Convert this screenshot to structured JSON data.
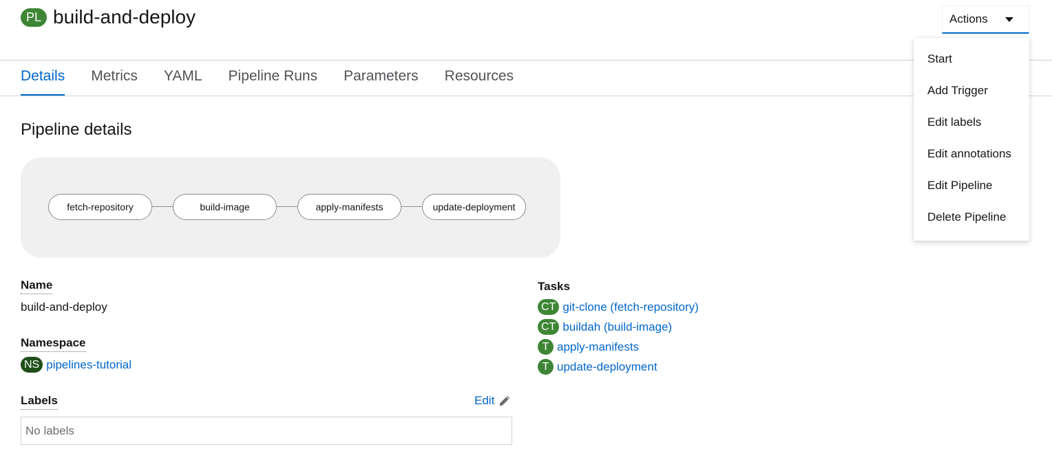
{
  "header": {
    "badge": "PL",
    "title": "build-and-deploy",
    "actions_label": "Actions"
  },
  "actions_menu": {
    "items": [
      "Start",
      "Add Trigger",
      "Edit labels",
      "Edit annotations",
      "Edit Pipeline",
      "Delete Pipeline"
    ]
  },
  "tabs": [
    {
      "label": "Details",
      "active": true
    },
    {
      "label": "Metrics",
      "active": false
    },
    {
      "label": "YAML",
      "active": false
    },
    {
      "label": "Pipeline Runs",
      "active": false
    },
    {
      "label": "Parameters",
      "active": false
    },
    {
      "label": "Resources",
      "active": false
    }
  ],
  "section_title": "Pipeline details",
  "pipeline_graph": {
    "nodes": [
      "fetch-repository",
      "build-image",
      "apply-manifests",
      "update-deployment"
    ]
  },
  "details": {
    "name_label": "Name",
    "name_value": "build-and-deploy",
    "namespace_label": "Namespace",
    "namespace_badge": "NS",
    "namespace_value": "pipelines-tutorial",
    "labels_label": "Labels",
    "labels_edit": "Edit",
    "labels_empty": "No labels"
  },
  "tasks": {
    "label": "Tasks",
    "items": [
      {
        "badge": "CT",
        "text": "git-clone (fetch-repository)"
      },
      {
        "badge": "CT",
        "text": "buildah (build-image)"
      },
      {
        "badge": "T",
        "text": "apply-manifests"
      },
      {
        "badge": "T",
        "text": "update-deployment"
      }
    ]
  },
  "colors": {
    "accent": "#0066cc",
    "badge_green": "#3e8635",
    "badge_dark_green": "#1e4f18"
  }
}
